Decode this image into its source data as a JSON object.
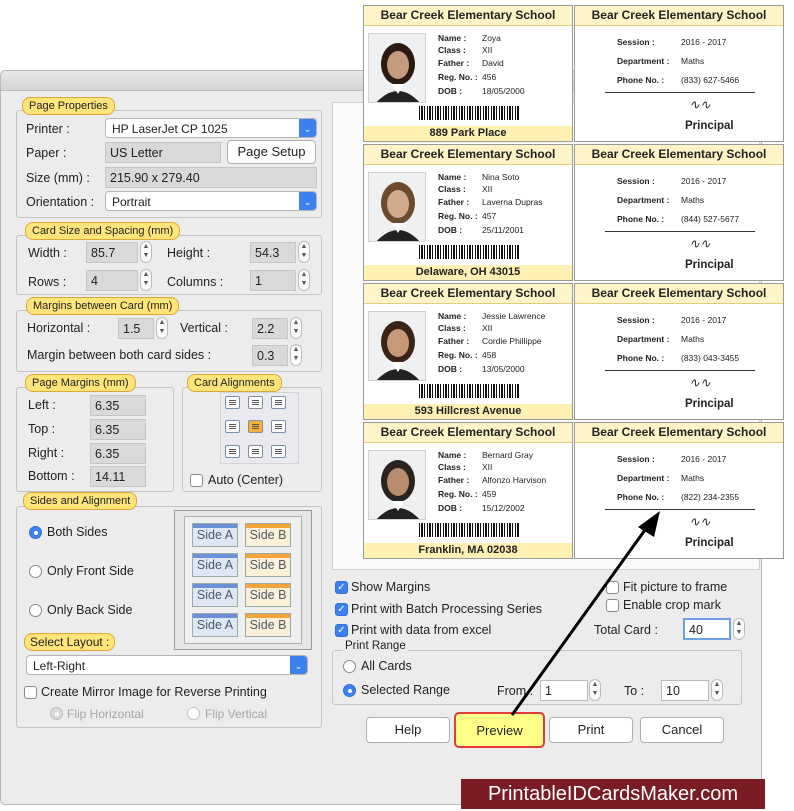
{
  "page_properties": {
    "title": "Page Properties",
    "printer_label": "Printer :",
    "printer_value": "HP LaserJet CP 1025",
    "paper_label": "Paper :",
    "paper_value": "US Letter",
    "page_setup_label": "Page Setup",
    "size_label": "Size (mm) :",
    "size_value": "215.90 x 279.40",
    "orientation_label": "Orientation :",
    "orientation_value": "Portrait"
  },
  "card_size": {
    "title": "Card Size and Spacing (mm)",
    "width_label": "Width :",
    "width_value": "85.7",
    "height_label": "Height :",
    "height_value": "54.3",
    "rows_label": "Rows :",
    "rows_value": "4",
    "columns_label": "Columns :",
    "columns_value": "1"
  },
  "margins_between": {
    "title": "Margins between Card (mm)",
    "horizontal_label": "Horizontal :",
    "horizontal_value": "1.5",
    "vertical_label": "Vertical :",
    "vertical_value": "2.2",
    "both_sides_label": "Margin between both card sides :",
    "both_sides_value": "0.3"
  },
  "page_margins": {
    "title": "Page Margins (mm)",
    "left_label": "Left :",
    "left_value": "6.35",
    "top_label": "Top :",
    "top_value": "6.35",
    "right_label": "Right :",
    "right_value": "6.35",
    "bottom_label": "Bottom :",
    "bottom_value": "14.11"
  },
  "card_alignments": {
    "title": "Card Alignments",
    "auto_center_label": "Auto (Center)"
  },
  "sides": {
    "title": "Sides and Alignment",
    "both_sides": "Both Sides",
    "front_side": "Only Front Side",
    "back_side": "Only Back Side",
    "side_a": "Side A",
    "side_b": "Side B",
    "select_layout_label": "Select Layout :",
    "layout_value": "Left-Right",
    "mirror_label": "Create Mirror Image for Reverse Printing",
    "flip_horizontal": "Flip Horizontal",
    "flip_vertical": "Flip Vertical"
  },
  "options": {
    "show_margins": "Show Margins",
    "batch_series": "Print with Batch Processing Series",
    "data_excel": "Print with data from excel",
    "fit_picture": "Fit picture to frame",
    "crop_mark": "Enable crop mark",
    "total_card_label": "Total Card :",
    "total_card_value": "40"
  },
  "print_range": {
    "title": "Print Range",
    "all_cards": "All Cards",
    "selected_range": "Selected Range",
    "from_label": "From :",
    "from_value": "1",
    "to_label": "To :",
    "to_value": "10"
  },
  "buttons": {
    "help": "Help",
    "preview": "Preview",
    "print": "Print",
    "cancel": "Cancel"
  },
  "cards": [
    {
      "school": "Bear Creek Elementary School",
      "name": "Zoya",
      "class": "XII",
      "father": "David",
      "reg": "456",
      "dob": "18/05/2000",
      "address": "889 Park Place",
      "session": "2016 - 2017",
      "department": "Maths",
      "phone": "(833) 627-5466"
    },
    {
      "school": "Bear Creek Elementary School",
      "name": "Nina Soto",
      "class": "XII",
      "father": "Laverna Dupras",
      "reg": "457",
      "dob": "25/11/2001",
      "address": "Delaware, OH 43015",
      "session": "2016 - 2017",
      "department": "Maths",
      "phone": "(844) 527-5677"
    },
    {
      "school": "Bear Creek Elementary School",
      "name": "Jessie Lawrence",
      "class": "XII",
      "father": "Cordie Phillippe",
      "reg": "458",
      "dob": "13/05/2000",
      "address": "593 Hillcrest Avenue",
      "session": "2016 - 2017",
      "department": "Maths",
      "phone": "(833) 043-3455"
    },
    {
      "school": "Bear Creek Elementary School",
      "name": "Bernard Gray",
      "class": "XII",
      "father": "Alfonzo Harvison",
      "reg": "459",
      "dob": "15/12/2002",
      "address": "Franklin, MA 02038",
      "session": "2016 - 2017",
      "department": "Maths",
      "phone": "(822) 234-2355"
    }
  ],
  "card_labels": {
    "name": "Name :",
    "class": "Class :",
    "father": "Father :",
    "reg": "Reg. No. :",
    "dob": "DOB :",
    "session": "Session :",
    "department": "Department :",
    "phone": "Phone No. :",
    "principal": "Principal"
  },
  "brand": "PrintableIDCardsMaker.com"
}
